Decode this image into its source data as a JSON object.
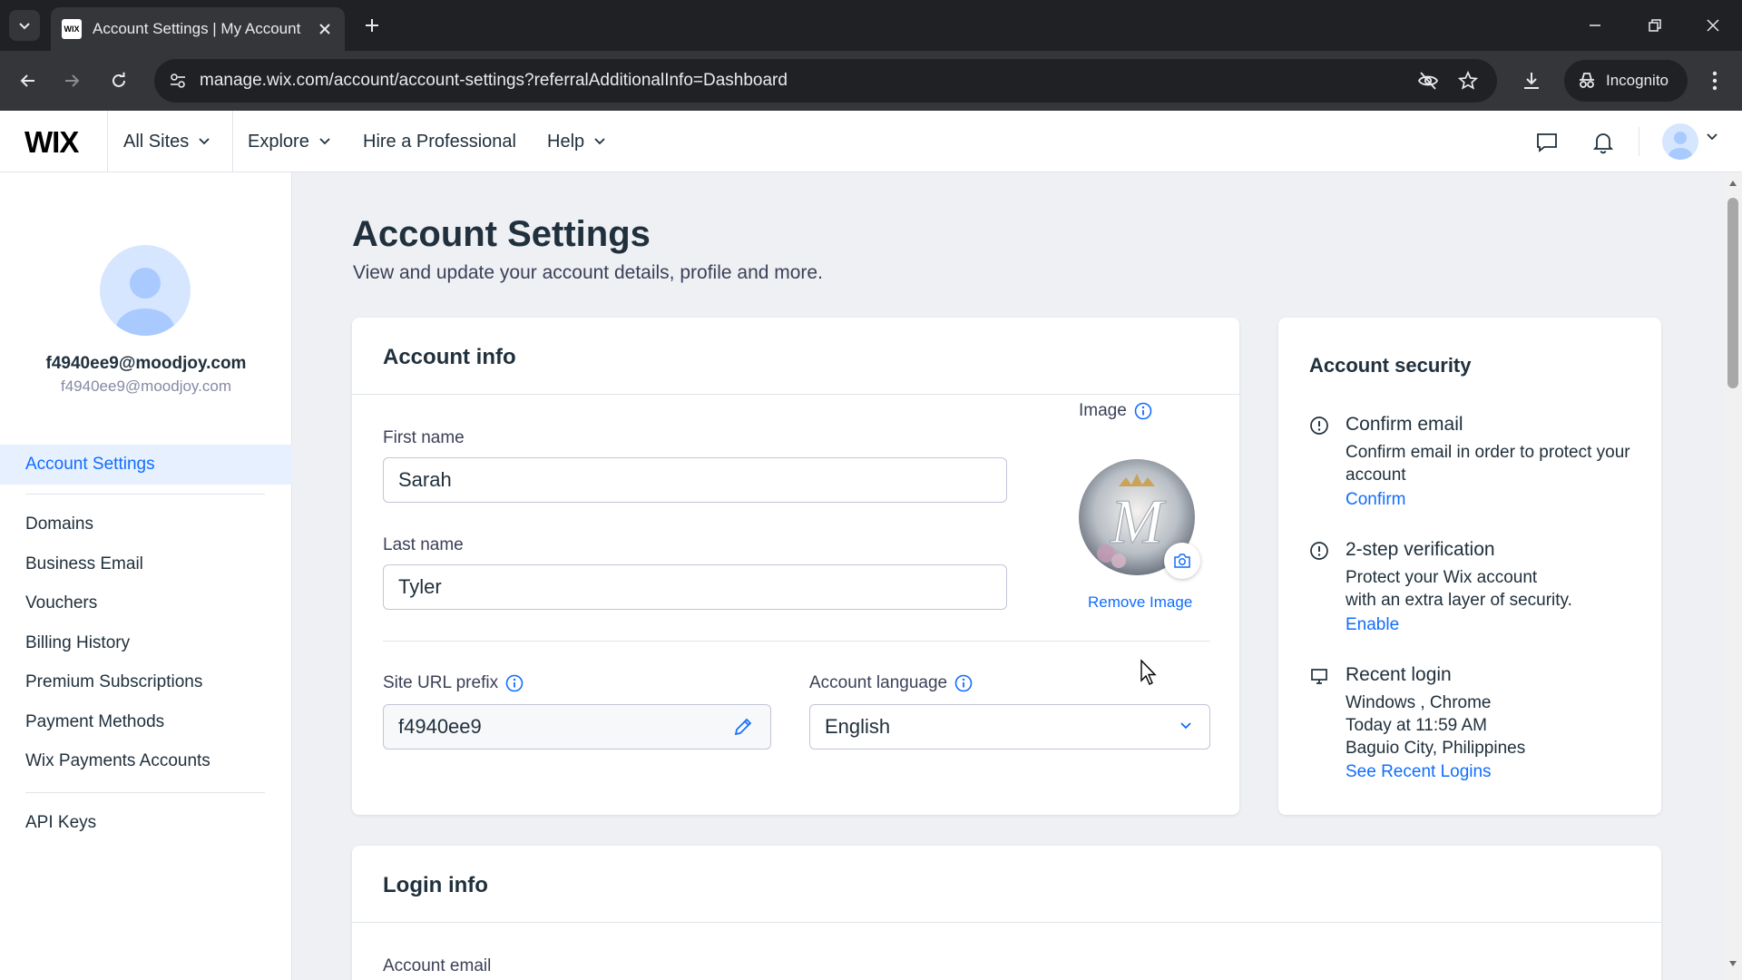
{
  "browser": {
    "tab_title": "Account Settings | My Account",
    "favicon_text": "WIX",
    "url": "manage.wix.com/account/account-settings?referralAdditionalInfo=Dashboard",
    "incognito_label": "Incognito"
  },
  "header": {
    "logo": "WIX",
    "nav": [
      {
        "label": "All Sites"
      },
      {
        "label": "Explore"
      },
      {
        "label": "Hire a Professional"
      },
      {
        "label": "Help"
      }
    ]
  },
  "sidebar": {
    "email_primary": "f4940ee9@moodjoy.com",
    "email_secondary": "f4940ee9@moodjoy.com",
    "items": [
      {
        "label": "Account Settings",
        "active": true
      },
      {
        "label": "Domains"
      },
      {
        "label": "Business Email"
      },
      {
        "label": "Vouchers"
      },
      {
        "label": "Billing History"
      },
      {
        "label": "Premium Subscriptions"
      },
      {
        "label": "Payment Methods"
      },
      {
        "label": "Wix Payments Accounts"
      },
      {
        "label": "API Keys"
      }
    ]
  },
  "main": {
    "title": "Account Settings",
    "subtitle": "View and update your account details, profile and more."
  },
  "account_info": {
    "title": "Account info",
    "first_name_label": "First name",
    "first_name_value": "Sarah",
    "last_name_label": "Last name",
    "last_name_value": "Tyler",
    "image_label": "Image",
    "image_letter": "M",
    "remove_image": "Remove Image",
    "site_url_label": "Site URL prefix",
    "site_url_value": "f4940ee9",
    "language_label": "Account language",
    "language_value": "English"
  },
  "security": {
    "title": "Account security",
    "confirm_email": {
      "title": "Confirm email",
      "text": "Confirm email in order to protect your account",
      "link": "Confirm"
    },
    "two_step": {
      "title": "2-step verification",
      "text_line1": "Protect your Wix account",
      "text_line2": "with an extra layer of security.",
      "link": "Enable"
    },
    "recent_login": {
      "title": "Recent login",
      "line1": "Windows , Chrome",
      "line2": "Today at 11:59 AM",
      "line3": "Baguio City, Philippines",
      "link": "See Recent Logins"
    }
  },
  "login_info": {
    "title": "Login info",
    "account_email_label": "Account email"
  },
  "colors": {
    "accent": "#116dff",
    "page_bg": "#eef0f4",
    "text": "#20303c"
  }
}
